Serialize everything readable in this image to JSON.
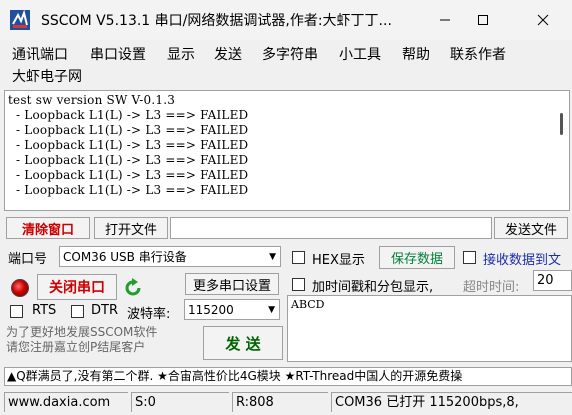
{
  "window": {
    "title": "SSCOM V5.13.1 串口/网络数据调试器,作者:大虾丁丁...",
    "icons": {
      "app": "sscom-app-icon",
      "minimize": "minimize-icon",
      "maximize": "maximize-icon",
      "close": "close-icon"
    }
  },
  "menu": {
    "items": [
      "通讯端口",
      "串口设置",
      "显示",
      "发送",
      "多字符串",
      "小工具",
      "帮助",
      "联系作者"
    ],
    "second_line": "大虾电子网"
  },
  "output": {
    "text": "test sw version SW V-0.1.3\n  - Loopback L1(L) -> L3 ==> FAILED\n  - Loopback L1(L) -> L3 ==> FAILED\n  - Loopback L1(L) -> L3 ==> FAILED\n  - Loopback L1(L) -> L3 ==> FAILED\n  - Loopback L1(L) -> L3 ==> FAILED\n  - Loopback L1(L) -> L3 ==> FAILED"
  },
  "toolbar": {
    "clear_window": "清除窗口",
    "open_file": "打开文件",
    "file_path": "",
    "send_file": "发送文件"
  },
  "port": {
    "port_label": "端口号",
    "port_value": "COM36 USB 串行设备",
    "close_port": "关闭串口",
    "more_settings": "更多串口设置",
    "rts": "RTS",
    "dtr": "DTR",
    "baud_label": "波特率:",
    "baud_value": "115200",
    "promo": "为了更好地发展SSCOM软件\n请您注册嘉立创P结尾客户",
    "send": "发 送"
  },
  "options": {
    "hex_display": "HEX显示",
    "save_data": "保存数据",
    "receive_to": "接收数据到文",
    "timestamp": "加时间戳和分包显示,",
    "timeout_label": "超时时间:",
    "timeout_value": "20"
  },
  "send_box": {
    "text": "ABCD"
  },
  "ad": {
    "text": "▲Q群满员了,没有第二个群. ★合宙高性价比4G模块 ★RT-Thread中国人的开源免费操"
  },
  "status": {
    "site": "www.daxia.com",
    "sent": "S:0",
    "received": "R:808",
    "port_state": "COM36 已打开  115200bps,8,"
  },
  "colors": {
    "accent_red": "#cc0000",
    "save_green": "#00803c",
    "receive_blue": "#1a2fb0"
  }
}
